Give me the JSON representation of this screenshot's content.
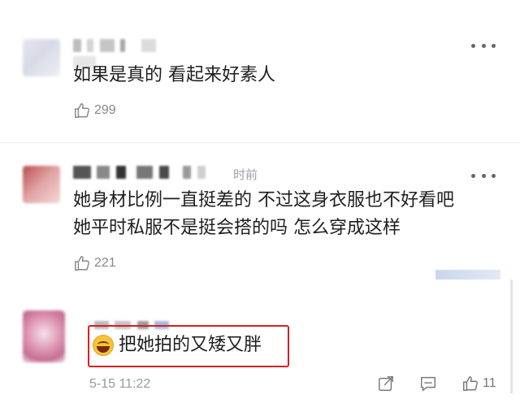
{
  "comments": [
    {
      "text": "如果是真的  看起来好素人",
      "likes": "299"
    },
    {
      "time_suffix": "时前",
      "lines": [
        "她身材比例一直挺差的 不过这身衣服也不好看吧",
        "她平时私服不是挺会搭的吗 怎么穿成这样"
      ],
      "likes": "221"
    }
  ],
  "reply": {
    "text": "把她拍的又矮又胖",
    "timestamp": "5-15 11:22",
    "likes": "11"
  },
  "icons": {
    "like": "thumbs-up-icon",
    "more": "more-dots-icon",
    "share": "share-icon",
    "comment": "comment-icon",
    "emoji": "crying-laughing-emoji-icon"
  },
  "colors": {
    "highlight": "#d72020",
    "meta": "#9a9a9a"
  }
}
